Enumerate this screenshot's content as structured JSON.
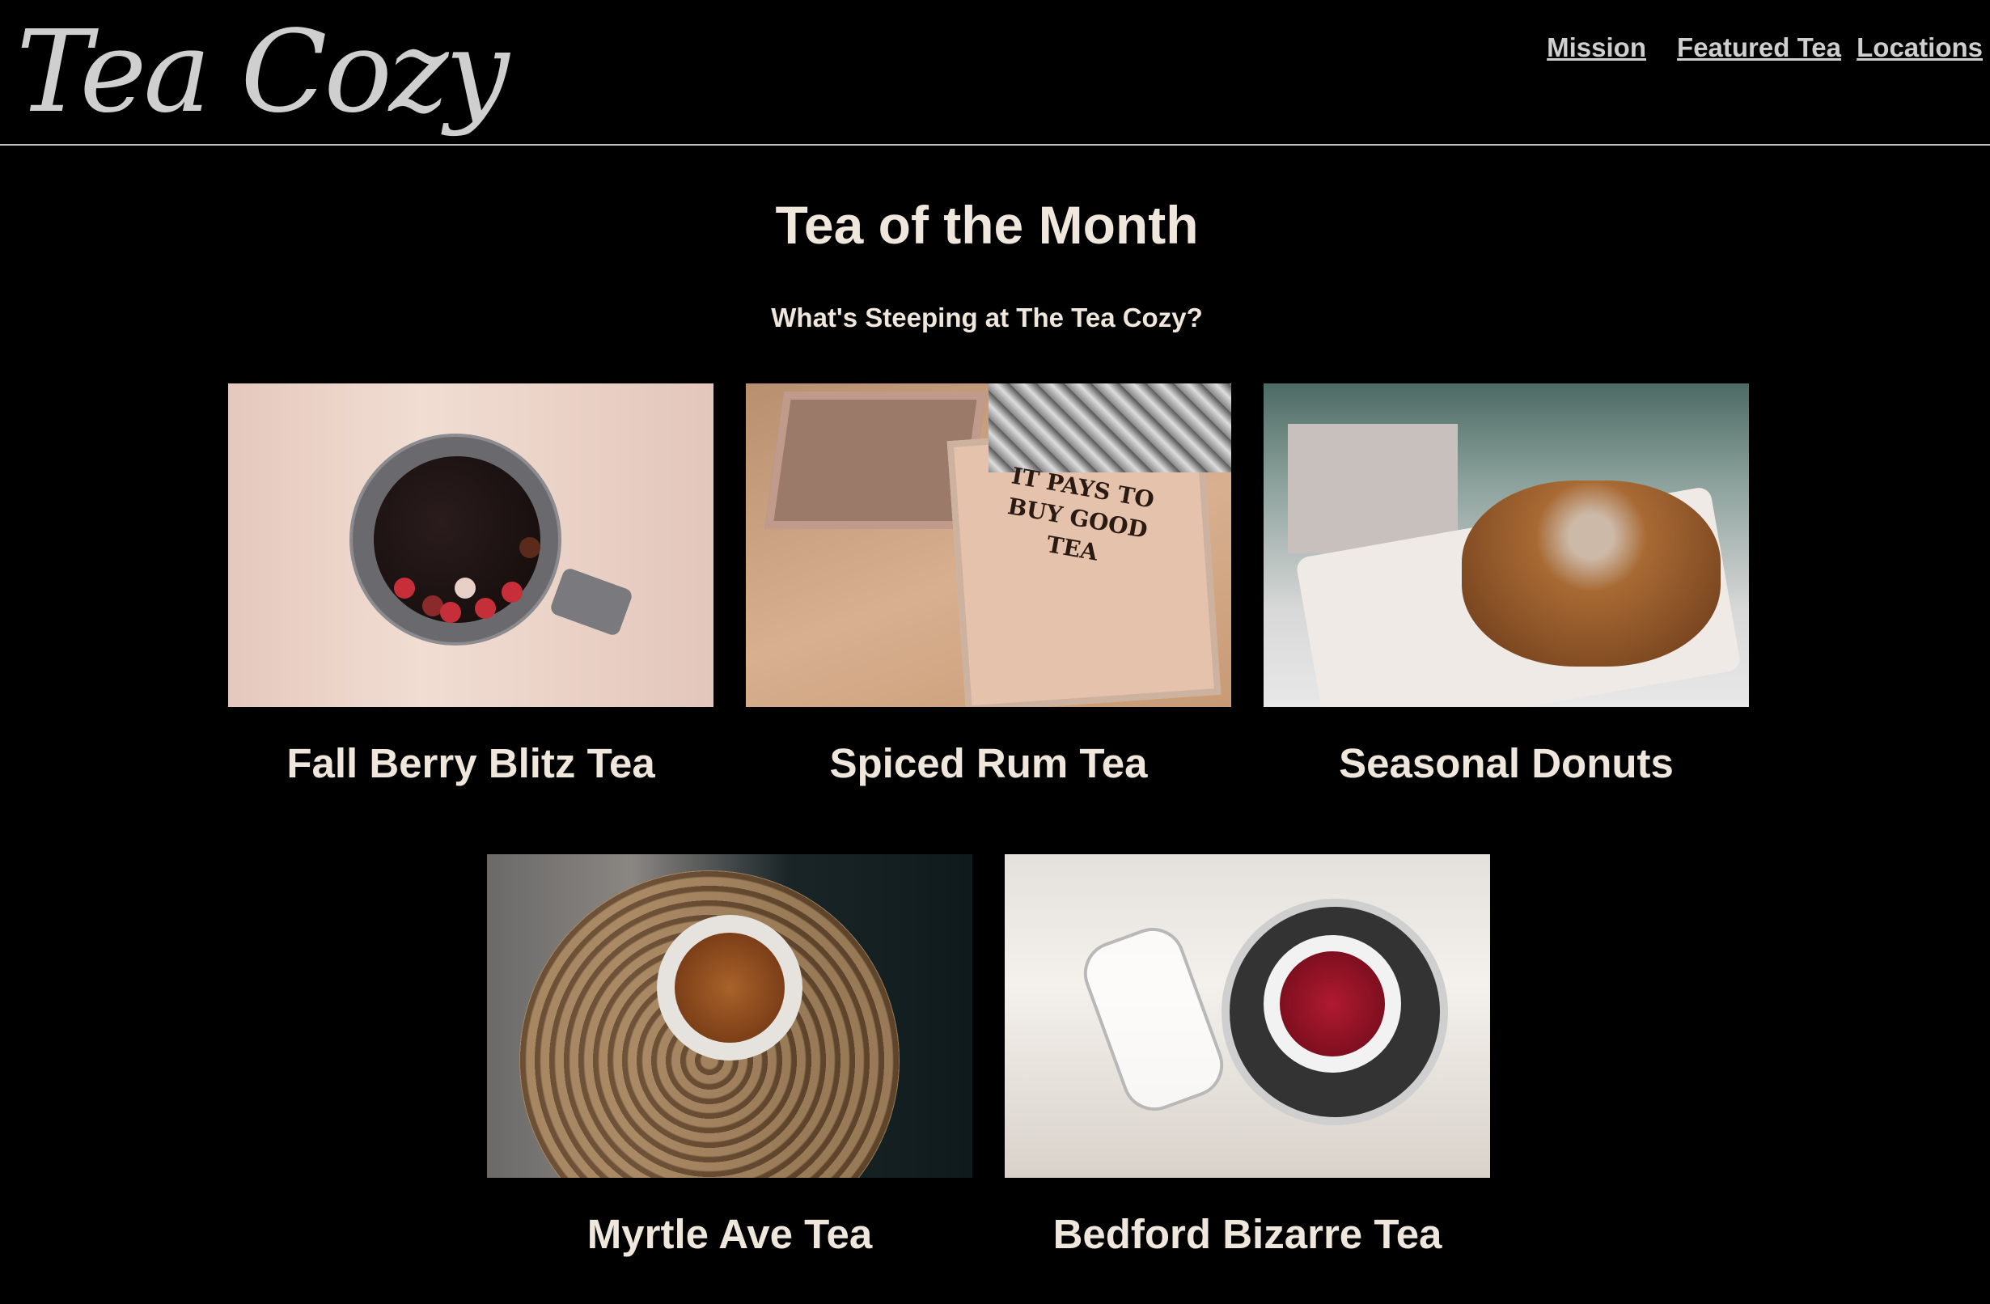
{
  "header": {
    "logo_text": "Tea Cozy",
    "nav": [
      {
        "label": "Mission"
      },
      {
        "label": "Featured Tea"
      },
      {
        "label": "Locations"
      }
    ]
  },
  "main": {
    "title": "Tea of the Month",
    "subtitle": "What's Steeping at The Tea Cozy?",
    "items": [
      {
        "name": "Fall Berry Blitz Tea"
      },
      {
        "name": "Spiced Rum Tea",
        "box_text": "IT PAYS TO BUY GOOD TEA"
      },
      {
        "name": "Seasonal Donuts"
      },
      {
        "name": "Myrtle Ave Tea"
      },
      {
        "name": "Bedford Bizarre Tea"
      }
    ]
  },
  "colors": {
    "background": "#000000",
    "text": "#efe6dc",
    "logo": "#cfcfcf",
    "nav_link": "#cfcfcf",
    "divider": "#bfbfbf"
  }
}
